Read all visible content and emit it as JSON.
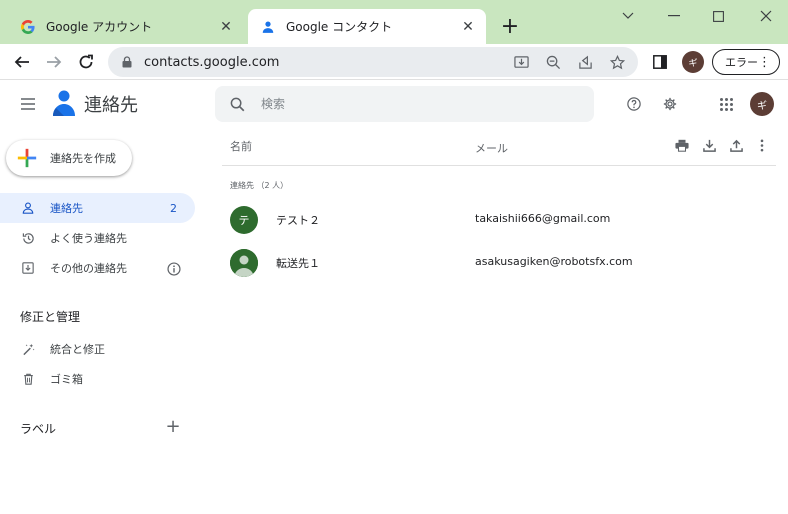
{
  "browser": {
    "tabs": [
      {
        "title": "Google アカウント",
        "active": false
      },
      {
        "title": "Google コンタクト",
        "active": true
      }
    ],
    "url": "contacts.google.com",
    "profile_initial": "ギ",
    "error_label": "エラー"
  },
  "app": {
    "name": "連絡先",
    "search_placeholder": "検索",
    "avatar_initial": "ギ"
  },
  "sidebar": {
    "create_label": "連絡先を作成",
    "items": [
      {
        "label": "連絡先",
        "count": "2"
      },
      {
        "label": "よく使う連絡先"
      },
      {
        "label": "その他の連絡先"
      }
    ],
    "manage_title": "修正と管理",
    "manage_items": [
      {
        "label": "統合と修正"
      },
      {
        "label": "ゴミ箱"
      }
    ],
    "labels_title": "ラベル"
  },
  "list": {
    "col_name": "名前",
    "col_email": "メール",
    "group_label": "連絡先 （2 人）",
    "contacts": [
      {
        "initial": "テ",
        "name": "テスト２",
        "email": "takaishii666@gmail.com"
      },
      {
        "initial": "",
        "name": "転送先１",
        "email": "asakusagiken@robotsfx.com"
      }
    ]
  },
  "colors": {
    "tabstrip": "#c9e6bf",
    "active_nav_bg": "#e8f0fe",
    "active_nav_text": "#1a56c6",
    "avatar_green": "#2e6b2e",
    "profile_brown": "#5c3d35"
  }
}
